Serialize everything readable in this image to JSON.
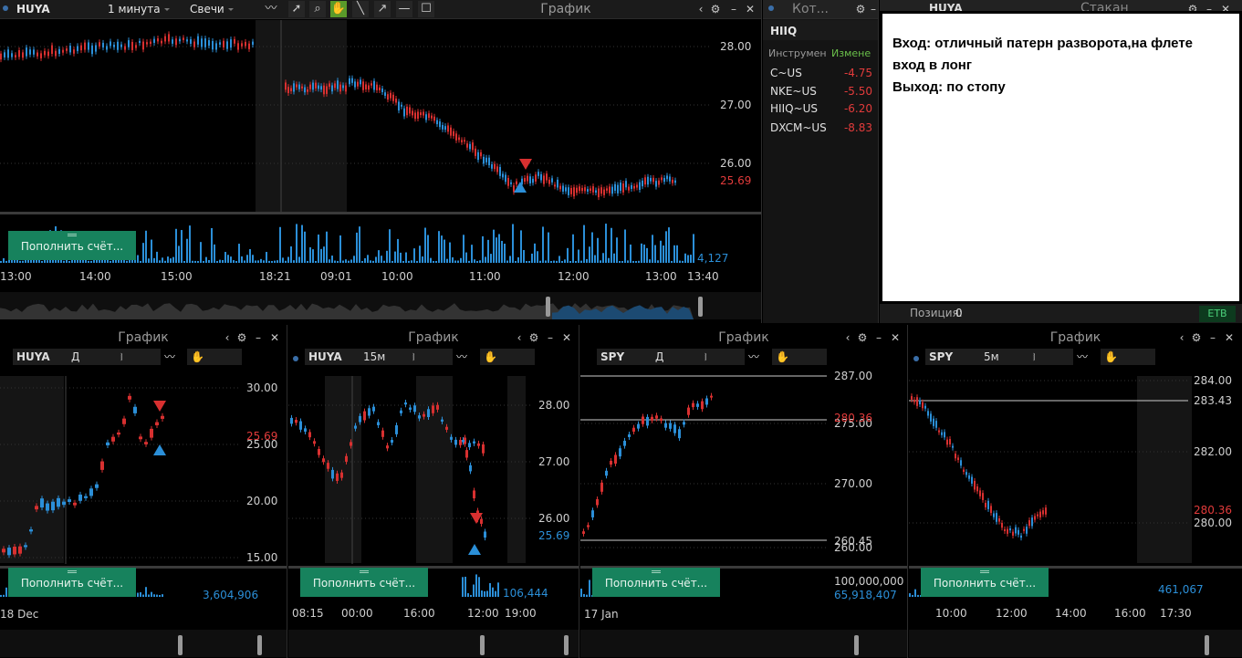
{
  "main": {
    "symbol": "HUYA",
    "interval": "1 минута",
    "chart_type": "Свечи",
    "title": "График",
    "prices": [
      "28.00",
      "27.00",
      "26.00"
    ],
    "last_price": "25.69",
    "volume": "4,127",
    "times": [
      "13:00",
      "14:00",
      "15:00",
      "18:21",
      "09:01",
      "10:00",
      "11:00",
      "12:00",
      "13:00",
      "13:40"
    ],
    "deposit": "Пополнить счёт..."
  },
  "quotes": {
    "title": "Кот...",
    "symbol": "HIIQ",
    "col_instrument": "Инструмен",
    "col_change": "Измене",
    "rows": [
      {
        "name": "C~US",
        "change": "-4.75"
      },
      {
        "name": "NKE~US",
        "change": "-5.50"
      },
      {
        "name": "HIIQ~US",
        "change": "-6.20"
      },
      {
        "name": "DXCM~US",
        "change": "-8.83"
      }
    ]
  },
  "orderbook": {
    "symbol": "HUYA",
    "title": "Стакан",
    "position_label": "Позиция:",
    "position_value": "0",
    "exchange": "ETB"
  },
  "note": {
    "line1": "Вход: отличный патерн разворота,на флете",
    "line2": "вход в лонг",
    "line3": "Выход: по стопу"
  },
  "p1": {
    "title": "График",
    "symbol": "HUYA",
    "interval": "Д",
    "prices": [
      "30.00",
      "25.00",
      "20.00",
      "15.00"
    ],
    "last": "25.69",
    "volume": "3,604,906",
    "date": "18 Dec",
    "deposit": "Пополнить счёт..."
  },
  "p2": {
    "title": "График",
    "symbol": "HUYA",
    "interval": "15м",
    "prices": [
      "28.00",
      "27.00",
      "26.00"
    ],
    "last": "25.69",
    "volume": "106,444",
    "times": [
      "08:15",
      "00:00",
      "16:00",
      "12:00",
      "19:00"
    ],
    "deposit": "Пополнить счёт..."
  },
  "p3": {
    "title": "График",
    "symbol": "SPY",
    "interval": "Д",
    "prices": [
      "287.00",
      "275.00",
      "270.00",
      "260.00"
    ],
    "line_top": "287.00",
    "line_mid": "280.36",
    "line_low": "260.45",
    "volume_axis": "100,000,000",
    "volume": "65,918,407",
    "date": "17 Jan",
    "deposit": "Пополнить счёт..."
  },
  "p4": {
    "title": "График",
    "symbol": "SPY",
    "interval": "5м",
    "prices": [
      "284.00",
      "282.00",
      "280.00"
    ],
    "line_top": "283.43",
    "last": "280.36",
    "volume": "461,067",
    "times": [
      "10:00",
      "12:00",
      "14:00",
      "16:00",
      "17:30"
    ],
    "deposit": "Пополнить счёт..."
  },
  "colors": {
    "up": "#2b8fd8",
    "down": "#d83030",
    "accent_green": "#17825d",
    "tool_active": "#5a9a2a"
  }
}
